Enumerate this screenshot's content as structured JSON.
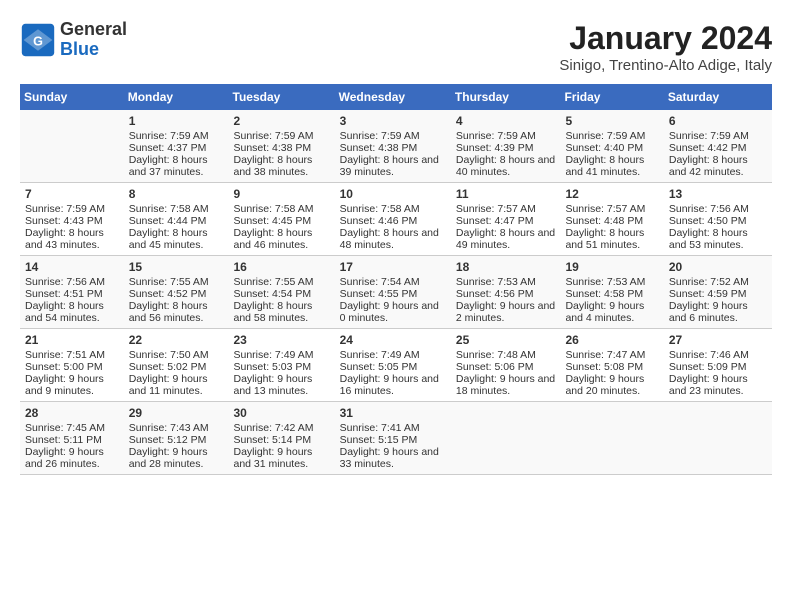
{
  "header": {
    "logo_general": "General",
    "logo_blue": "Blue",
    "title": "January 2024",
    "subtitle": "Sinigo, Trentino-Alto Adige, Italy"
  },
  "days_of_week": [
    "Sunday",
    "Monday",
    "Tuesday",
    "Wednesday",
    "Thursday",
    "Friday",
    "Saturday"
  ],
  "weeks": [
    [
      {
        "day": "",
        "sunrise": "",
        "sunset": "",
        "daylight": ""
      },
      {
        "day": "1",
        "sunrise": "Sunrise: 7:59 AM",
        "sunset": "Sunset: 4:37 PM",
        "daylight": "Daylight: 8 hours and 37 minutes."
      },
      {
        "day": "2",
        "sunrise": "Sunrise: 7:59 AM",
        "sunset": "Sunset: 4:38 PM",
        "daylight": "Daylight: 8 hours and 38 minutes."
      },
      {
        "day": "3",
        "sunrise": "Sunrise: 7:59 AM",
        "sunset": "Sunset: 4:38 PM",
        "daylight": "Daylight: 8 hours and 39 minutes."
      },
      {
        "day": "4",
        "sunrise": "Sunrise: 7:59 AM",
        "sunset": "Sunset: 4:39 PM",
        "daylight": "Daylight: 8 hours and 40 minutes."
      },
      {
        "day": "5",
        "sunrise": "Sunrise: 7:59 AM",
        "sunset": "Sunset: 4:40 PM",
        "daylight": "Daylight: 8 hours and 41 minutes."
      },
      {
        "day": "6",
        "sunrise": "Sunrise: 7:59 AM",
        "sunset": "Sunset: 4:42 PM",
        "daylight": "Daylight: 8 hours and 42 minutes."
      }
    ],
    [
      {
        "day": "7",
        "sunrise": "Sunrise: 7:59 AM",
        "sunset": "Sunset: 4:43 PM",
        "daylight": "Daylight: 8 hours and 43 minutes."
      },
      {
        "day": "8",
        "sunrise": "Sunrise: 7:58 AM",
        "sunset": "Sunset: 4:44 PM",
        "daylight": "Daylight: 8 hours and 45 minutes."
      },
      {
        "day": "9",
        "sunrise": "Sunrise: 7:58 AM",
        "sunset": "Sunset: 4:45 PM",
        "daylight": "Daylight: 8 hours and 46 minutes."
      },
      {
        "day": "10",
        "sunrise": "Sunrise: 7:58 AM",
        "sunset": "Sunset: 4:46 PM",
        "daylight": "Daylight: 8 hours and 48 minutes."
      },
      {
        "day": "11",
        "sunrise": "Sunrise: 7:57 AM",
        "sunset": "Sunset: 4:47 PM",
        "daylight": "Daylight: 8 hours and 49 minutes."
      },
      {
        "day": "12",
        "sunrise": "Sunrise: 7:57 AM",
        "sunset": "Sunset: 4:48 PM",
        "daylight": "Daylight: 8 hours and 51 minutes."
      },
      {
        "day": "13",
        "sunrise": "Sunrise: 7:56 AM",
        "sunset": "Sunset: 4:50 PM",
        "daylight": "Daylight: 8 hours and 53 minutes."
      }
    ],
    [
      {
        "day": "14",
        "sunrise": "Sunrise: 7:56 AM",
        "sunset": "Sunset: 4:51 PM",
        "daylight": "Daylight: 8 hours and 54 minutes."
      },
      {
        "day": "15",
        "sunrise": "Sunrise: 7:55 AM",
        "sunset": "Sunset: 4:52 PM",
        "daylight": "Daylight: 8 hours and 56 minutes."
      },
      {
        "day": "16",
        "sunrise": "Sunrise: 7:55 AM",
        "sunset": "Sunset: 4:54 PM",
        "daylight": "Daylight: 8 hours and 58 minutes."
      },
      {
        "day": "17",
        "sunrise": "Sunrise: 7:54 AM",
        "sunset": "Sunset: 4:55 PM",
        "daylight": "Daylight: 9 hours and 0 minutes."
      },
      {
        "day": "18",
        "sunrise": "Sunrise: 7:53 AM",
        "sunset": "Sunset: 4:56 PM",
        "daylight": "Daylight: 9 hours and 2 minutes."
      },
      {
        "day": "19",
        "sunrise": "Sunrise: 7:53 AM",
        "sunset": "Sunset: 4:58 PM",
        "daylight": "Daylight: 9 hours and 4 minutes."
      },
      {
        "day": "20",
        "sunrise": "Sunrise: 7:52 AM",
        "sunset": "Sunset: 4:59 PM",
        "daylight": "Daylight: 9 hours and 6 minutes."
      }
    ],
    [
      {
        "day": "21",
        "sunrise": "Sunrise: 7:51 AM",
        "sunset": "Sunset: 5:00 PM",
        "daylight": "Daylight: 9 hours and 9 minutes."
      },
      {
        "day": "22",
        "sunrise": "Sunrise: 7:50 AM",
        "sunset": "Sunset: 5:02 PM",
        "daylight": "Daylight: 9 hours and 11 minutes."
      },
      {
        "day": "23",
        "sunrise": "Sunrise: 7:49 AM",
        "sunset": "Sunset: 5:03 PM",
        "daylight": "Daylight: 9 hours and 13 minutes."
      },
      {
        "day": "24",
        "sunrise": "Sunrise: 7:49 AM",
        "sunset": "Sunset: 5:05 PM",
        "daylight": "Daylight: 9 hours and 16 minutes."
      },
      {
        "day": "25",
        "sunrise": "Sunrise: 7:48 AM",
        "sunset": "Sunset: 5:06 PM",
        "daylight": "Daylight: 9 hours and 18 minutes."
      },
      {
        "day": "26",
        "sunrise": "Sunrise: 7:47 AM",
        "sunset": "Sunset: 5:08 PM",
        "daylight": "Daylight: 9 hours and 20 minutes."
      },
      {
        "day": "27",
        "sunrise": "Sunrise: 7:46 AM",
        "sunset": "Sunset: 5:09 PM",
        "daylight": "Daylight: 9 hours and 23 minutes."
      }
    ],
    [
      {
        "day": "28",
        "sunrise": "Sunrise: 7:45 AM",
        "sunset": "Sunset: 5:11 PM",
        "daylight": "Daylight: 9 hours and 26 minutes."
      },
      {
        "day": "29",
        "sunrise": "Sunrise: 7:43 AM",
        "sunset": "Sunset: 5:12 PM",
        "daylight": "Daylight: 9 hours and 28 minutes."
      },
      {
        "day": "30",
        "sunrise": "Sunrise: 7:42 AM",
        "sunset": "Sunset: 5:14 PM",
        "daylight": "Daylight: 9 hours and 31 minutes."
      },
      {
        "day": "31",
        "sunrise": "Sunrise: 7:41 AM",
        "sunset": "Sunset: 5:15 PM",
        "daylight": "Daylight: 9 hours and 33 minutes."
      },
      {
        "day": "",
        "sunrise": "",
        "sunset": "",
        "daylight": ""
      },
      {
        "day": "",
        "sunrise": "",
        "sunset": "",
        "daylight": ""
      },
      {
        "day": "",
        "sunrise": "",
        "sunset": "",
        "daylight": ""
      }
    ]
  ]
}
